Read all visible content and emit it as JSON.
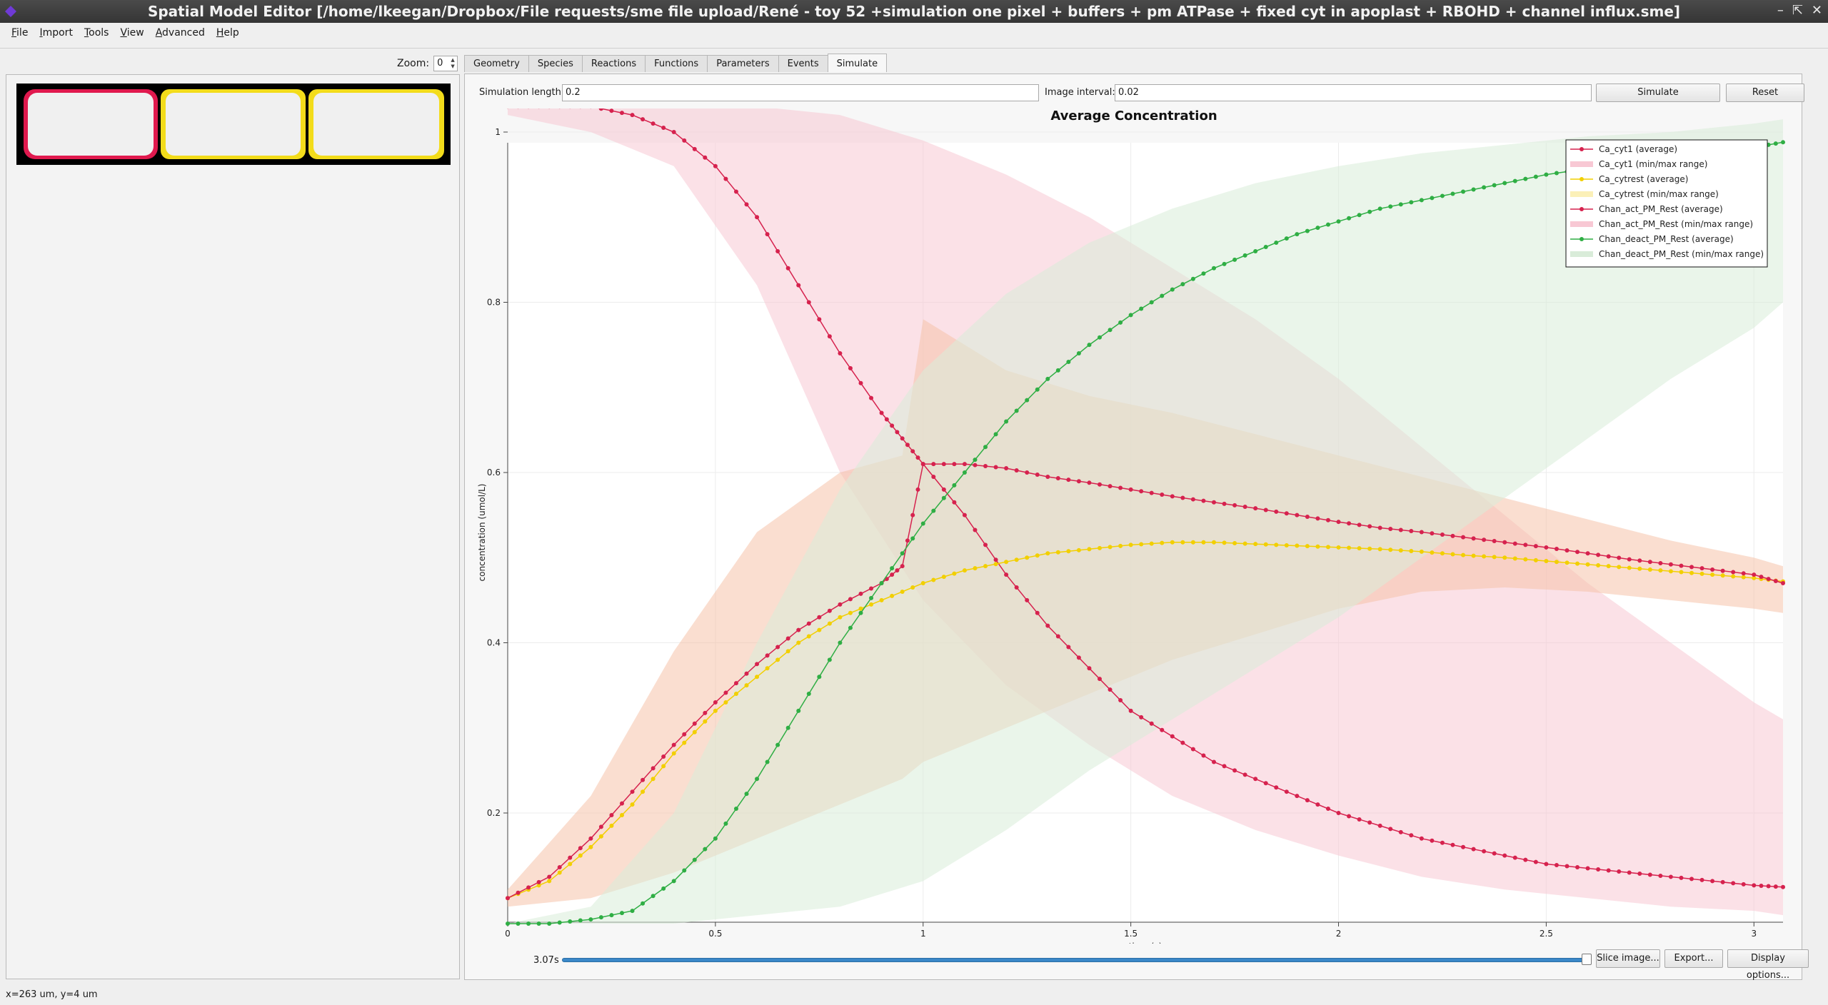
{
  "window": {
    "title": "Spatial Model Editor [/home/lkeegan/Dropbox/File requests/sme file upload/René - toy 52 +simulation one pixel + buffers + pm ATPase + fixed cyt in apoplast + RBOHD + channel influx.sme]",
    "min_glyph": "–",
    "max_glyph": "⇱",
    "close_glyph": "✕"
  },
  "menu": {
    "items": [
      {
        "key": "F",
        "rest": "ile"
      },
      {
        "key": "I",
        "rest": "mport"
      },
      {
        "key": "T",
        "rest": "ools"
      },
      {
        "key": "V",
        "rest": "iew"
      },
      {
        "key": "A",
        "rest": "dvanced"
      },
      {
        "key": "H",
        "rest": "elp"
      }
    ]
  },
  "left": {
    "zoom_label": "Zoom:",
    "zoom_value": "0",
    "compartment_colors": [
      "#e0194e",
      "#f3dc1b",
      "#f3dc1b"
    ]
  },
  "tabs": [
    "Geometry",
    "Species",
    "Reactions",
    "Functions",
    "Parameters",
    "Events",
    "Simulate"
  ],
  "simulate": {
    "length_label": "Simulation length:",
    "length_value": "0.2",
    "interval_label": "Image interval:",
    "interval_value": "0.02",
    "simulate_button": "Simulate",
    "reset_button": "Reset",
    "time_value": "3.07s",
    "slice_button": "Slice image...",
    "export_button": "Export...",
    "display_button": "Display options...",
    "slider_position": 1.0
  },
  "status": {
    "text": "x=263 um, y=4 um"
  },
  "chart_data": {
    "type": "line",
    "title": "Average Concentration",
    "xlabel": "time (s)",
    "ylabel": "concentration (umol/L)",
    "xlim": [
      0,
      3.07
    ],
    "ylim": [
      0.06,
      1.03
    ],
    "xticks": [
      0,
      0.5,
      1,
      1.5,
      2,
      2.5,
      3
    ],
    "yticks": [
      0.2,
      0.4,
      0.6,
      0.8,
      1
    ],
    "grid": true,
    "legend_position": "top-right",
    "legend": [
      {
        "label": "Ca_cyt1 (average)",
        "kind": "line",
        "color": "#d6224e"
      },
      {
        "label": "Ca_cyt1 (min/max range)",
        "kind": "band",
        "color": "#f8c8d4"
      },
      {
        "label": "Ca_cytrest (average)",
        "kind": "line",
        "color": "#f2cf00"
      },
      {
        "label": "Ca_cytrest (min/max range)",
        "kind": "band",
        "color": "#fbf0b8"
      },
      {
        "label": "Chan_act_PM_Rest (average)",
        "kind": "line",
        "color": "#d6224e"
      },
      {
        "label": "Chan_act_PM_Rest (min/max range)",
        "kind": "band",
        "color": "#f8c8d4"
      },
      {
        "label": "Chan_deact_PM_Rest (average)",
        "kind": "line",
        "color": "#2fae44"
      },
      {
        "label": "Chan_deact_PM_Rest (min/max range)",
        "kind": "band",
        "color": "#d9ecd9"
      }
    ],
    "series": [
      {
        "name": "Ca_cyt1 (average)",
        "color": "#d6224e",
        "x": [
          0,
          0.1,
          0.2,
          0.3,
          0.4,
          0.5,
          0.6,
          0.7,
          0.8,
          0.9,
          0.95,
          1.0,
          1.1,
          1.2,
          1.3,
          1.4,
          1.5,
          1.6,
          1.7,
          1.8,
          1.9,
          2.0,
          2.1,
          2.2,
          2.3,
          2.4,
          2.5,
          2.6,
          2.7,
          2.8,
          2.9,
          3.0,
          3.07
        ],
        "y": [
          1.03,
          1.03,
          1.03,
          1.02,
          1.0,
          0.96,
          0.9,
          0.82,
          0.74,
          0.67,
          0.64,
          0.61,
          0.55,
          0.48,
          0.42,
          0.37,
          0.32,
          0.29,
          0.26,
          0.24,
          0.22,
          0.2,
          0.185,
          0.17,
          0.16,
          0.15,
          0.14,
          0.135,
          0.13,
          0.125,
          0.12,
          0.115,
          0.113
        ]
      },
      {
        "name": "Ca_cytrest (average)",
        "color": "#f2cf00",
        "x": [
          0,
          0.1,
          0.2,
          0.3,
          0.4,
          0.5,
          0.6,
          0.7,
          0.8,
          0.9,
          1.0,
          1.1,
          1.2,
          1.3,
          1.4,
          1.5,
          1.6,
          1.7,
          1.8,
          1.9,
          2.0,
          2.1,
          2.2,
          2.3,
          2.4,
          2.5,
          2.6,
          2.7,
          2.8,
          2.9,
          3.0,
          3.07
        ],
        "y": [
          0.1,
          0.12,
          0.16,
          0.21,
          0.27,
          0.32,
          0.36,
          0.4,
          0.43,
          0.45,
          0.47,
          0.485,
          0.495,
          0.505,
          0.51,
          0.515,
          0.518,
          0.518,
          0.516,
          0.514,
          0.512,
          0.51,
          0.507,
          0.503,
          0.5,
          0.496,
          0.492,
          0.488,
          0.484,
          0.48,
          0.476,
          0.472
        ]
      },
      {
        "name": "Chan_act_PM_Rest (average)",
        "color": "#d6224e",
        "x": [
          0,
          0.1,
          0.2,
          0.3,
          0.4,
          0.5,
          0.6,
          0.7,
          0.8,
          0.9,
          0.95,
          1.0,
          1.1,
          1.2,
          1.3,
          1.4,
          1.5,
          1.6,
          1.7,
          1.8,
          1.9,
          2.0,
          2.1,
          2.2,
          2.3,
          2.4,
          2.5,
          2.6,
          2.7,
          2.8,
          2.9,
          3.0,
          3.07
        ],
        "y": [
          0.1,
          0.125,
          0.17,
          0.225,
          0.28,
          0.33,
          0.375,
          0.415,
          0.445,
          0.47,
          0.49,
          0.61,
          0.61,
          0.605,
          0.595,
          0.588,
          0.58,
          0.572,
          0.565,
          0.558,
          0.55,
          0.542,
          0.535,
          0.53,
          0.524,
          0.518,
          0.512,
          0.505,
          0.498,
          0.492,
          0.486,
          0.48,
          0.47
        ]
      },
      {
        "name": "Chan_deact_PM_Rest (average)",
        "color": "#2fae44",
        "x": [
          0,
          0.1,
          0.2,
          0.3,
          0.4,
          0.5,
          0.6,
          0.7,
          0.8,
          0.9,
          1.0,
          1.1,
          1.2,
          1.3,
          1.4,
          1.5,
          1.6,
          1.7,
          1.8,
          1.9,
          2.0,
          2.1,
          2.2,
          2.3,
          2.4,
          2.5,
          2.6,
          2.7,
          2.8,
          2.9,
          3.0,
          3.07
        ],
        "y": [
          0.07,
          0.07,
          0.075,
          0.085,
          0.12,
          0.17,
          0.24,
          0.32,
          0.4,
          0.47,
          0.54,
          0.6,
          0.66,
          0.71,
          0.75,
          0.785,
          0.815,
          0.84,
          0.86,
          0.88,
          0.895,
          0.91,
          0.92,
          0.93,
          0.94,
          0.95,
          0.957,
          0.964,
          0.97,
          0.976,
          0.982,
          0.988
        ]
      }
    ],
    "bands": [
      {
        "name": "Ca_cyt1 (min/max range)",
        "color": "#f8c8d4",
        "x": [
          0,
          0.2,
          0.4,
          0.6,
          0.8,
          1.0,
          1.2,
          1.4,
          1.6,
          1.8,
          2.0,
          2.2,
          2.4,
          2.6,
          2.8,
          3.0,
          3.07
        ],
        "ymax": [
          1.03,
          1.03,
          1.03,
          1.03,
          1.02,
          0.99,
          0.95,
          0.9,
          0.84,
          0.78,
          0.71,
          0.63,
          0.55,
          0.47,
          0.4,
          0.33,
          0.31
        ],
        "ymin": [
          1.02,
          1.0,
          0.96,
          0.82,
          0.6,
          0.45,
          0.35,
          0.28,
          0.22,
          0.18,
          0.15,
          0.125,
          0.11,
          0.1,
          0.09,
          0.085,
          0.08
        ]
      },
      {
        "name": "Chan_act_PM_Rest (min/max range)",
        "color": "#f6c3a9",
        "x": [
          0,
          0.2,
          0.4,
          0.6,
          0.8,
          0.95,
          1.0,
          1.2,
          1.4,
          1.6,
          1.8,
          2.0,
          2.2,
          2.4,
          2.6,
          2.8,
          3.0,
          3.07
        ],
        "ymax": [
          0.11,
          0.22,
          0.39,
          0.53,
          0.6,
          0.62,
          0.78,
          0.72,
          0.69,
          0.67,
          0.645,
          0.62,
          0.595,
          0.57,
          0.545,
          0.52,
          0.5,
          0.49
        ],
        "ymin": [
          0.09,
          0.1,
          0.13,
          0.17,
          0.21,
          0.24,
          0.26,
          0.3,
          0.34,
          0.38,
          0.41,
          0.44,
          0.46,
          0.465,
          0.46,
          0.45,
          0.44,
          0.435
        ]
      },
      {
        "name": "Chan_deact_PM_Rest (min/max range)",
        "color": "#d9ecd9",
        "x": [
          0,
          0.2,
          0.4,
          0.6,
          0.8,
          1.0,
          1.2,
          1.4,
          1.6,
          1.8,
          2.0,
          2.2,
          2.4,
          2.6,
          2.8,
          3.0,
          3.07
        ],
        "ymax": [
          0.07,
          0.09,
          0.2,
          0.4,
          0.58,
          0.72,
          0.81,
          0.87,
          0.91,
          0.94,
          0.96,
          0.975,
          0.985,
          0.995,
          1.0,
          1.01,
          1.015
        ],
        "ymin": [
          0.07,
          0.07,
          0.07,
          0.08,
          0.09,
          0.12,
          0.18,
          0.25,
          0.31,
          0.37,
          0.43,
          0.5,
          0.57,
          0.64,
          0.71,
          0.77,
          0.8
        ]
      }
    ]
  }
}
